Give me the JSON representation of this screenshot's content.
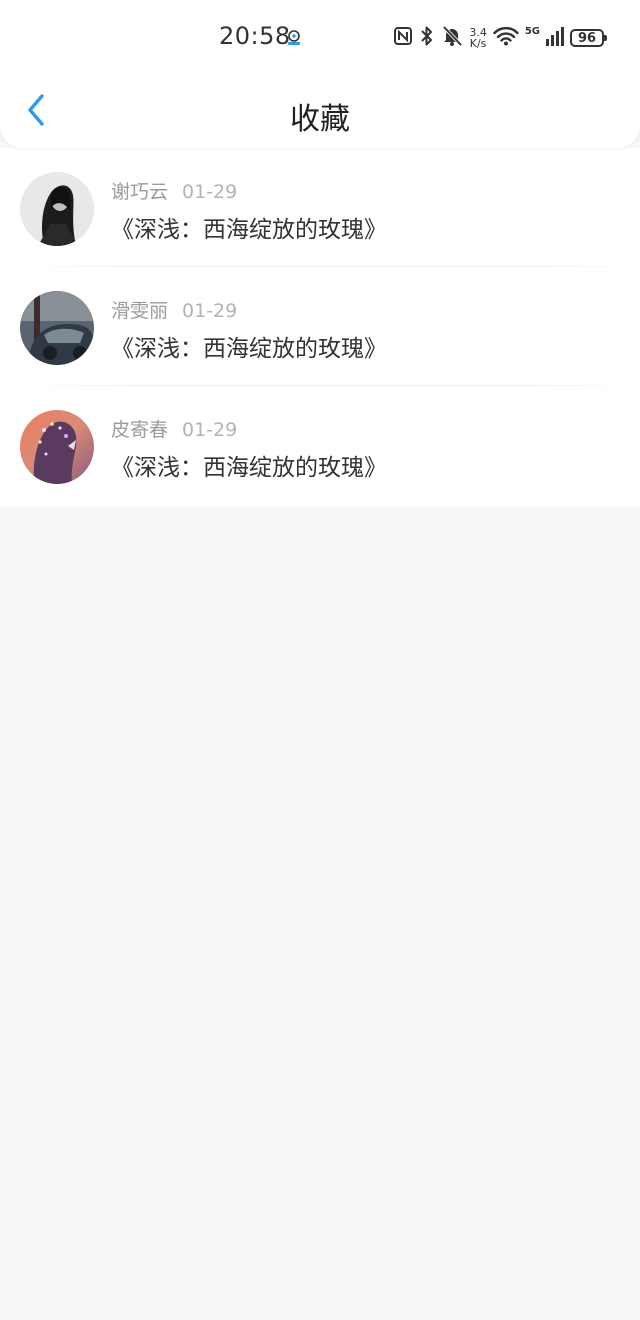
{
  "status_bar": {
    "time": "20:58",
    "net_speed_value": "3.4",
    "net_speed_unit": "K/s",
    "network_type": "5G",
    "battery_level": "96",
    "icons": [
      "nfc-icon",
      "bluetooth-icon",
      "bell-muted-icon",
      "wifi-icon",
      "signal-icon",
      "battery-icon"
    ]
  },
  "header": {
    "title": "收藏",
    "back_icon": "chevron-left-icon",
    "accent_color": "#2f9be6"
  },
  "favorites": [
    {
      "user": "谢巧云",
      "date": "01-29",
      "title": "《深浅：西海绽放的玫瑰》"
    },
    {
      "user": "滑雯丽",
      "date": "01-29",
      "title": "《深浅：西海绽放的玫瑰》"
    },
    {
      "user": "皮寄春",
      "date": "01-29",
      "title": "《深浅：西海绽放的玫瑰》"
    }
  ]
}
